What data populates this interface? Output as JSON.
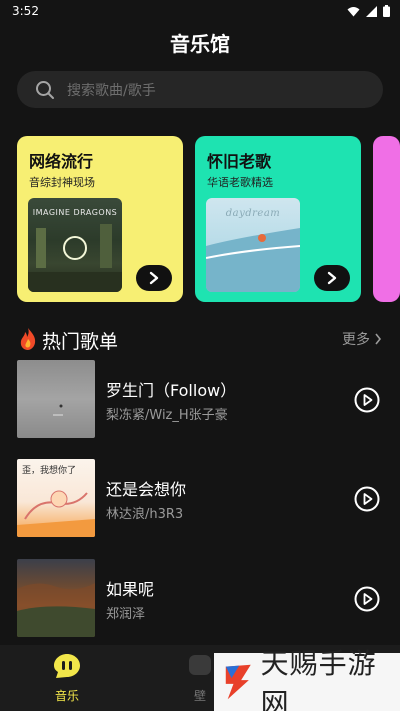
{
  "status": {
    "time": "3:52"
  },
  "header": {
    "title": "音乐馆"
  },
  "search": {
    "placeholder": "搜索歌曲/歌手"
  },
  "cards": [
    {
      "title": "网络流行",
      "subtitle": "音综封神现场",
      "cover_text": "IMAGINE DRAGONS",
      "color": "#f7ef73"
    },
    {
      "title": "怀旧老歌",
      "subtitle": "华语老歌精选",
      "cover_text": "daydream",
      "color": "#1ee3b1"
    },
    {
      "color": "#f06fe6"
    }
  ],
  "section": {
    "title": "热门歌单",
    "more": "更多"
  },
  "songs": [
    {
      "title": "罗生门（Follow）",
      "artist": "梨冻紧/Wiz_H张子豪"
    },
    {
      "title": "还是会想你",
      "artist": "林达浪/h3R3",
      "cover_text": "歪，我想你了"
    },
    {
      "title": "如果呢",
      "artist": "郑润泽"
    }
  ],
  "nav": {
    "music_label": "音乐",
    "second_label": "壁"
  },
  "watermark": {
    "text": "天赐手游网"
  },
  "colors": {
    "accent": "#f2e64a",
    "background": "#141414"
  }
}
